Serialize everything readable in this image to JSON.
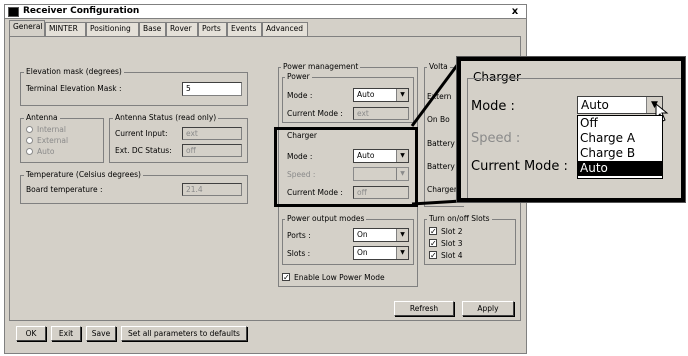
{
  "window": {
    "title": "Receiver Configuration",
    "close_glyph": "x"
  },
  "tabs": [
    "General",
    "MINTER",
    "Positioning",
    "Base",
    "Rover",
    "Ports",
    "Events",
    "Advanced"
  ],
  "elevation": {
    "group_title": "Elevation mask (degrees)",
    "label": "Terminal Elevation Mask :",
    "value": "5"
  },
  "antenna": {
    "group_title": "Antenna",
    "options": [
      "Internal",
      "External",
      "Auto"
    ]
  },
  "antenna_status": {
    "group_title": "Antenna Status (read only)",
    "current_input_label": "Current Input:",
    "current_input_value": "ext",
    "dc_status_label": "Ext. DC Status:",
    "dc_status_value": "off"
  },
  "temperature": {
    "group_title": "Temperature (Celsius degrees)",
    "label": "Board temperature :",
    "value": "21.4"
  },
  "power": {
    "group_title": "Power management",
    "sub_title": "Power",
    "mode_label": "Mode :",
    "mode_value": "Auto",
    "current_mode_label": "Current Mode :",
    "current_mode_value": "ext"
  },
  "charger": {
    "title": "Charger",
    "mode_label": "Mode :",
    "mode_value": "Auto",
    "speed_label": "Speed :",
    "speed_value": "",
    "current_mode_label": "Current Mode :",
    "current_mode_value": "off"
  },
  "voltages_cut": {
    "title": "Volta",
    "rows": [
      "Extern",
      "On Bo",
      "Battery",
      "Battery",
      "Charger"
    ]
  },
  "power_output": {
    "group_title": "Power output modes",
    "ports_label": "Ports :",
    "ports_value": "On",
    "slots_label": "Slots :",
    "slots_value": "On"
  },
  "slots": {
    "group_title": "Turn on/off Slots",
    "items": [
      "Slot 2",
      "Slot 3",
      "Slot 4"
    ],
    "check_glyph": "✓"
  },
  "low_power": {
    "label": "Enable Low Power Mode",
    "check_glyph": "✓"
  },
  "panel_buttons": {
    "refresh": "Refresh",
    "apply": "Apply"
  },
  "footer_buttons": {
    "ok": "OK",
    "exit": "Exit",
    "save": "Save",
    "defaults": "Set all parameters to defaults"
  },
  "zoom": {
    "title": "Charger",
    "mode_label": "Mode :",
    "mode_value": "Auto",
    "speed_label": "Speed :",
    "current_mode_label": "Current Mode :",
    "dropdown_options": [
      "Off",
      "Charge A",
      "Charge B",
      "Auto"
    ],
    "selected_option": "Auto"
  },
  "icons": {
    "combo_arrow": "▼"
  }
}
